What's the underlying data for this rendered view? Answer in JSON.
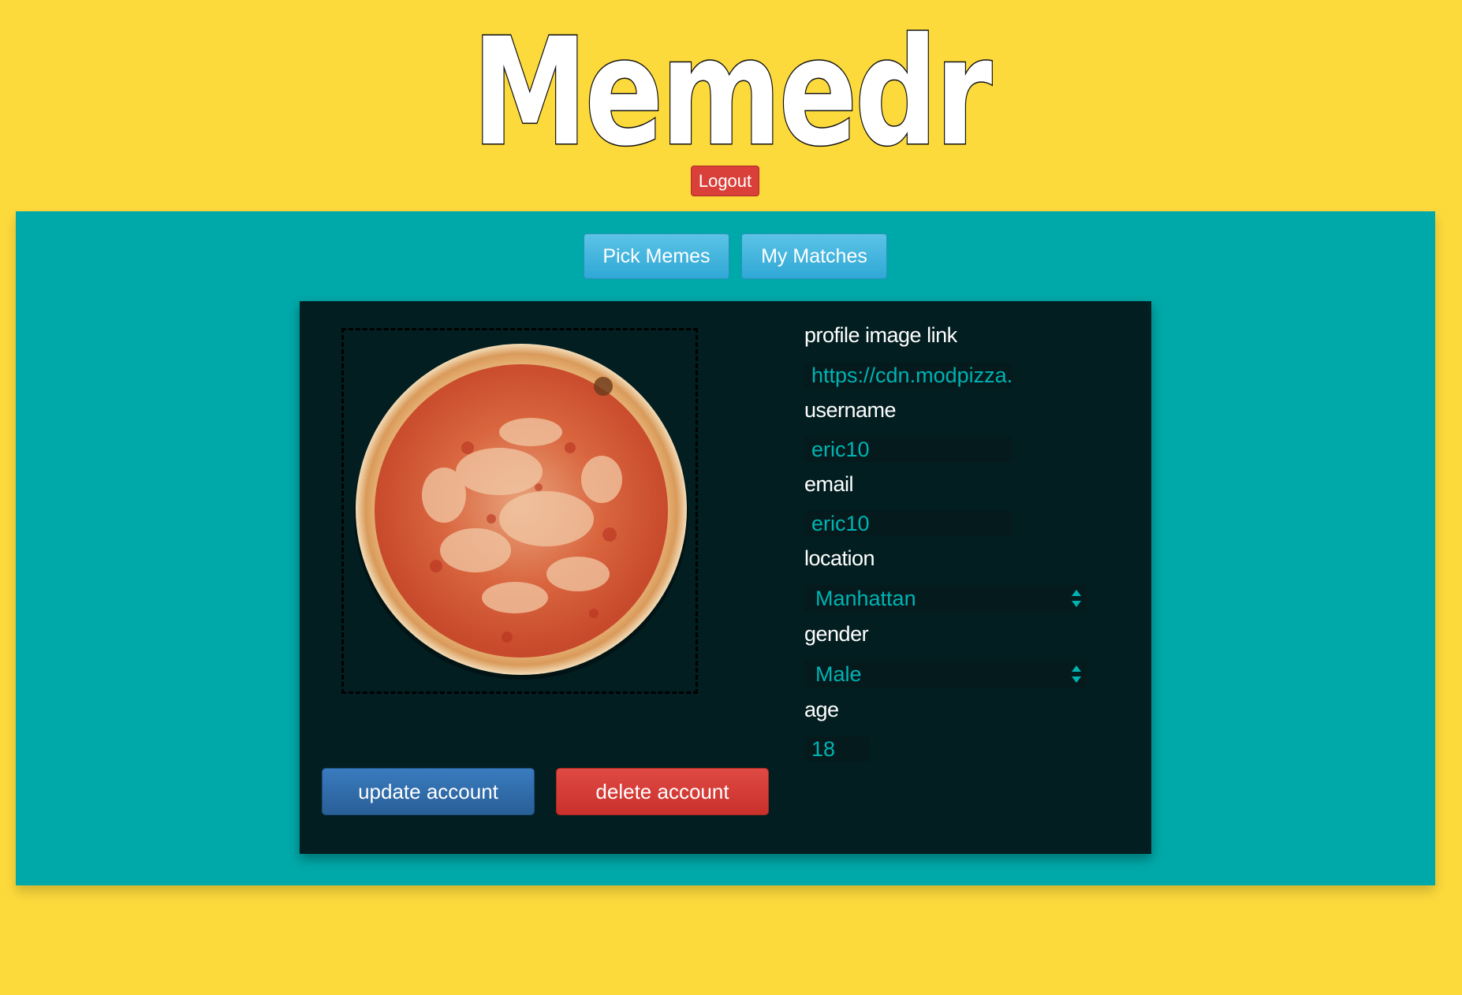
{
  "app": {
    "logo_text": "Memedr",
    "logout_label": "Logout"
  },
  "nav": {
    "pick_memes_label": "Pick Memes",
    "my_matches_label": "My Matches"
  },
  "profile": {
    "image_link_label": "profile image link",
    "image_link_value": "https://cdn.modpizza.c",
    "username_label": "username",
    "username_value": "eric10",
    "email_label": "email",
    "email_value": "eric10",
    "location_label": "location",
    "location_value": "Manhattan",
    "gender_label": "gender",
    "gender_value": "Male",
    "age_label": "age",
    "age_value": "18"
  },
  "actions": {
    "update_label": "update account",
    "delete_label": "delete account"
  },
  "colors": {
    "page_background": "#fdda3c",
    "band_background": "#00a9a9",
    "panel_background": "#021e20",
    "input_text": "#00b3b3",
    "logout_red": "#d9403a",
    "update_blue": "#3a7bbf",
    "delete_red": "#e04a44",
    "nav_button_blue": "#5cc3e6"
  },
  "icons": {
    "select_arrows": "updown-arrows-icon"
  }
}
